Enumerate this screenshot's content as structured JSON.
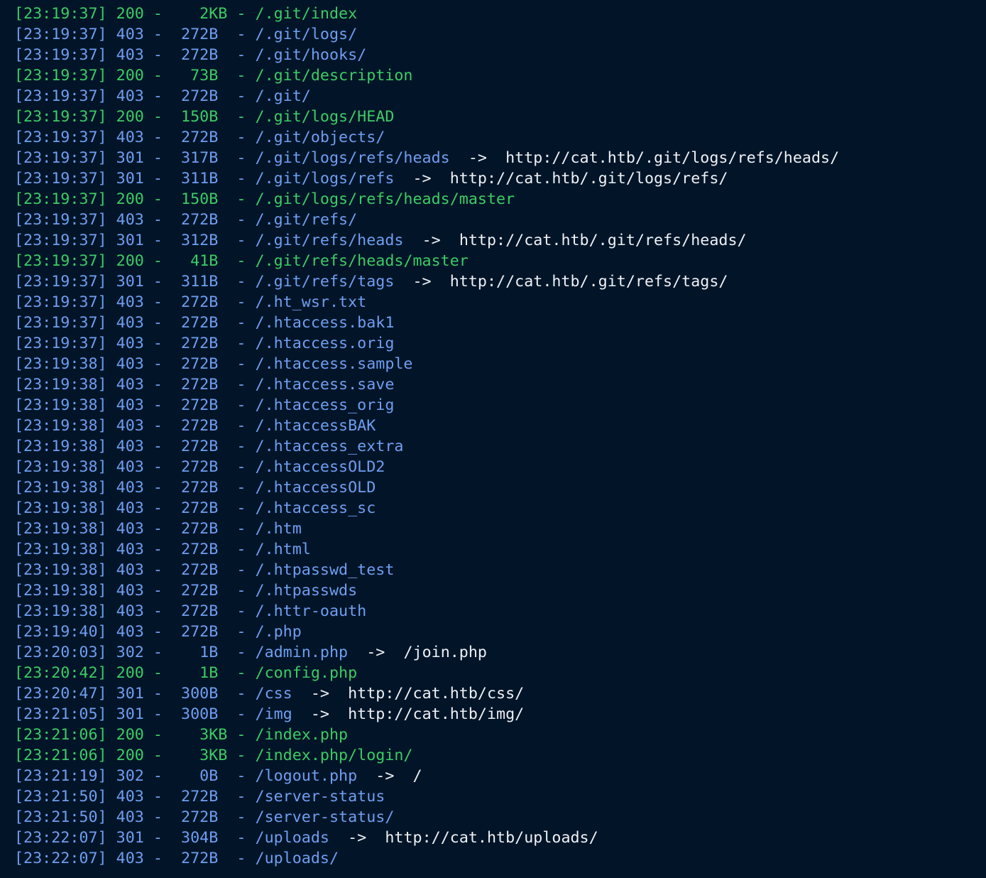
{
  "colors": {
    "background": "#021528",
    "status_200": "#3ccc65",
    "status_301": "#6f9ef2",
    "status_302": "#6f9ef2",
    "status_403": "#6f9ef2",
    "redirect_text": "#eef1f5"
  },
  "lines": [
    {
      "ts": "[23:19:37]",
      "status": "200",
      "size": "  2KB",
      "path": "/.git/index"
    },
    {
      "ts": "[23:19:37]",
      "status": "403",
      "size": "272B ",
      "path": "/.git/logs/"
    },
    {
      "ts": "[23:19:37]",
      "status": "403",
      "size": "272B ",
      "path": "/.git/hooks/"
    },
    {
      "ts": "[23:19:37]",
      "status": "200",
      "size": " 73B ",
      "path": "/.git/description"
    },
    {
      "ts": "[23:19:37]",
      "status": "403",
      "size": "272B ",
      "path": "/.git/"
    },
    {
      "ts": "[23:19:37]",
      "status": "200",
      "size": "150B ",
      "path": "/.git/logs/HEAD"
    },
    {
      "ts": "[23:19:37]",
      "status": "403",
      "size": "272B ",
      "path": "/.git/objects/"
    },
    {
      "ts": "[23:19:37]",
      "status": "301",
      "size": "317B ",
      "path": "/.git/logs/refs/heads",
      "arrow": "->",
      "target": "http://cat.htb/.git/logs/refs/heads/"
    },
    {
      "ts": "[23:19:37]",
      "status": "301",
      "size": "311B ",
      "path": "/.git/logs/refs",
      "arrow": "->",
      "target": "http://cat.htb/.git/logs/refs/"
    },
    {
      "ts": "[23:19:37]",
      "status": "200",
      "size": "150B ",
      "path": "/.git/logs/refs/heads/master"
    },
    {
      "ts": "[23:19:37]",
      "status": "403",
      "size": "272B ",
      "path": "/.git/refs/"
    },
    {
      "ts": "[23:19:37]",
      "status": "301",
      "size": "312B ",
      "path": "/.git/refs/heads",
      "arrow": "->",
      "target": "http://cat.htb/.git/refs/heads/"
    },
    {
      "ts": "[23:19:37]",
      "status": "200",
      "size": " 41B ",
      "path": "/.git/refs/heads/master"
    },
    {
      "ts": "[23:19:37]",
      "status": "301",
      "size": "311B ",
      "path": "/.git/refs/tags",
      "arrow": "->",
      "target": "http://cat.htb/.git/refs/tags/"
    },
    {
      "ts": "[23:19:37]",
      "status": "403",
      "size": "272B ",
      "path": "/.ht_wsr.txt"
    },
    {
      "ts": "[23:19:37]",
      "status": "403",
      "size": "272B ",
      "path": "/.htaccess.bak1"
    },
    {
      "ts": "[23:19:37]",
      "status": "403",
      "size": "272B ",
      "path": "/.htaccess.orig"
    },
    {
      "ts": "[23:19:38]",
      "status": "403",
      "size": "272B ",
      "path": "/.htaccess.sample"
    },
    {
      "ts": "[23:19:38]",
      "status": "403",
      "size": "272B ",
      "path": "/.htaccess.save"
    },
    {
      "ts": "[23:19:38]",
      "status": "403",
      "size": "272B ",
      "path": "/.htaccess_orig"
    },
    {
      "ts": "[23:19:38]",
      "status": "403",
      "size": "272B ",
      "path": "/.htaccessBAK"
    },
    {
      "ts": "[23:19:38]",
      "status": "403",
      "size": "272B ",
      "path": "/.htaccess_extra"
    },
    {
      "ts": "[23:19:38]",
      "status": "403",
      "size": "272B ",
      "path": "/.htaccessOLD2"
    },
    {
      "ts": "[23:19:38]",
      "status": "403",
      "size": "272B ",
      "path": "/.htaccessOLD"
    },
    {
      "ts": "[23:19:38]",
      "status": "403",
      "size": "272B ",
      "path": "/.htaccess_sc"
    },
    {
      "ts": "[23:19:38]",
      "status": "403",
      "size": "272B ",
      "path": "/.htm"
    },
    {
      "ts": "[23:19:38]",
      "status": "403",
      "size": "272B ",
      "path": "/.html"
    },
    {
      "ts": "[23:19:38]",
      "status": "403",
      "size": "272B ",
      "path": "/.htpasswd_test"
    },
    {
      "ts": "[23:19:38]",
      "status": "403",
      "size": "272B ",
      "path": "/.htpasswds"
    },
    {
      "ts": "[23:19:38]",
      "status": "403",
      "size": "272B ",
      "path": "/.httr-oauth"
    },
    {
      "ts": "[23:19:40]",
      "status": "403",
      "size": "272B ",
      "path": "/.php"
    },
    {
      "ts": "[23:20:03]",
      "status": "302",
      "size": "  1B ",
      "path": "/admin.php",
      "arrow": "->",
      "target": "/join.php"
    },
    {
      "ts": "[23:20:42]",
      "status": "200",
      "size": "  1B ",
      "path": "/config.php"
    },
    {
      "ts": "[23:20:47]",
      "status": "301",
      "size": "300B ",
      "path": "/css",
      "arrow": "->",
      "target": "http://cat.htb/css/"
    },
    {
      "ts": "[23:21:05]",
      "status": "301",
      "size": "300B ",
      "path": "/img",
      "arrow": "->",
      "target": "http://cat.htb/img/"
    },
    {
      "ts": "[23:21:06]",
      "status": "200",
      "size": "  3KB",
      "path": "/index.php"
    },
    {
      "ts": "[23:21:06]",
      "status": "200",
      "size": "  3KB",
      "path": "/index.php/login/"
    },
    {
      "ts": "[23:21:19]",
      "status": "302",
      "size": "  0B ",
      "path": "/logout.php",
      "arrow": "->",
      "target": "/"
    },
    {
      "ts": "[23:21:50]",
      "status": "403",
      "size": "272B ",
      "path": "/server-status"
    },
    {
      "ts": "[23:21:50]",
      "status": "403",
      "size": "272B ",
      "path": "/server-status/"
    },
    {
      "ts": "[23:22:07]",
      "status": "301",
      "size": "304B ",
      "path": "/uploads",
      "arrow": "->",
      "target": "http://cat.htb/uploads/"
    },
    {
      "ts": "[23:22:07]",
      "status": "403",
      "size": "272B ",
      "path": "/uploads/"
    }
  ]
}
